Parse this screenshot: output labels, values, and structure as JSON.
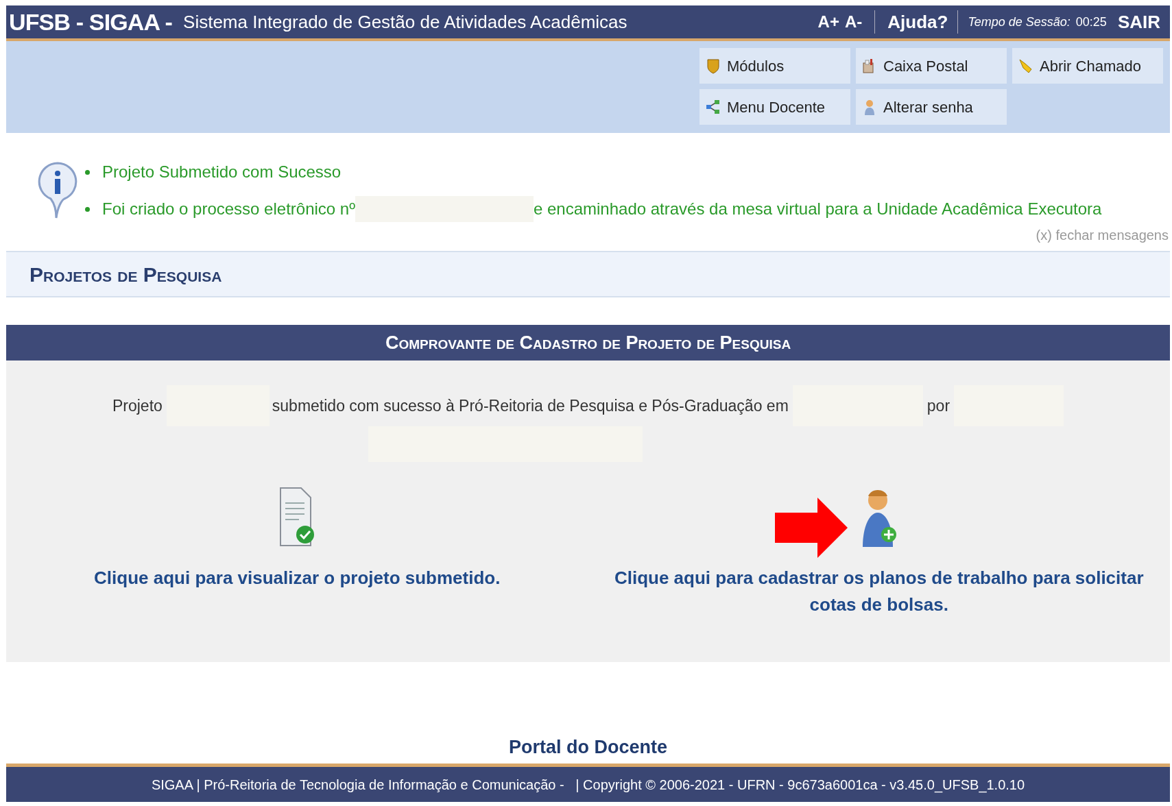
{
  "header": {
    "logo": "UFSB - SIGAA -",
    "system_name": "Sistema Integrado de Gestão de Atividades Acadêmicas",
    "font_controls": [
      "A+",
      "A-"
    ],
    "help": "Ajuda?",
    "session_label": "Tempo de Sessão:",
    "session_time": "00:25",
    "logout": "SAIR"
  },
  "shortcuts": [
    {
      "label": "Módulos"
    },
    {
      "label": "Caixa Postal"
    },
    {
      "label": "Abrir Chamado"
    },
    {
      "label": "Menu Docente"
    },
    {
      "label": "Alterar senha"
    }
  ],
  "messages": {
    "items": [
      {
        "text": "Projeto Submetido com Sucesso"
      },
      {
        "text": "Foi criado o processo eletrônico nº",
        "text_after": "e encaminhado através da mesa virtual para a Unidade Acadêmica Executora"
      }
    ],
    "close": "(x) fechar mensagens"
  },
  "page_title": "Projetos de Pesquisa",
  "panel": {
    "title": "Comprovante de Cadastro de Projeto de Pesquisa",
    "sentence": [
      "Projeto",
      "submetido com sucesso à Pró-Reitoria de Pesquisa e Pós-Graduação em",
      "por"
    ],
    "actions": [
      {
        "kind": "view",
        "label": "Clique aqui para visualizar o projeto submetido.",
        "highlighted": false
      },
      {
        "kind": "add",
        "label": "Clique aqui para cadastrar os planos de trabalho para solicitar cotas de bolsas.",
        "highlighted": true
      }
    ]
  },
  "footer": {
    "link": "Portal do Docente",
    "text": "SIGAA | Pró-Reitoria de Tecnologia de Informação e Comunicação -   | Copyright © 2006-2021 - UFRN - 9c673a6001ca - v3.45.0_UFSB_1.0.10"
  }
}
